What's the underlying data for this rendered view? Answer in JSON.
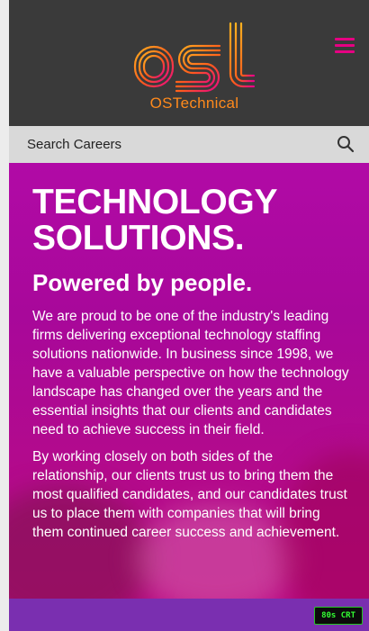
{
  "header": {
    "logo_mark": "ost",
    "logo_wordmark": "OSTechnical",
    "menu_icon": "hamburger-icon",
    "colors": {
      "background": "#3a3a3a",
      "accent": "#e60082",
      "logo_orange": "#ff8a1c"
    }
  },
  "search": {
    "placeholder": "Search Careers",
    "icon": "search-icon"
  },
  "hero": {
    "title_line1": "TECHNOLOGY",
    "title_line2": "SOLUTIONS.",
    "subtitle": "Powered by people.",
    "paragraph1": "We are proud to be one of the industry's leading firms delivering exceptional technology staffing solutions nationwide. In business since 1998, we have a valuable perspective on how the technology landscape has changed over the years and the essential insights that our clients and candidates need to achieve success in their field.",
    "paragraph2": "By working closely on both sides of the relationship, our clients trust us to bring them the most qualified candidates, and our candidates trust us to place them with companies that will bring them continued career success and achievement.",
    "colors": {
      "background": "#b10aa6",
      "text": "#ffffff"
    }
  },
  "footer_band": {
    "color": "#7a2fb0"
  },
  "crt_badge": {
    "label": "80s CRT"
  }
}
